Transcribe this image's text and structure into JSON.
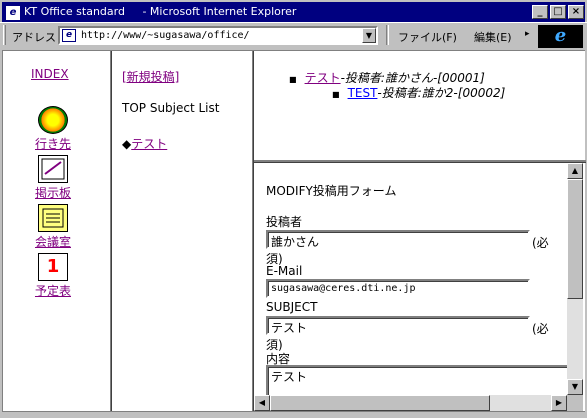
{
  "window": {
    "title": "KT Office standard     - Microsoft Internet Explorer",
    "app_icon": "ie-icon",
    "controls": {
      "minimize": "_",
      "maximize": "□",
      "close": "×"
    }
  },
  "address_bar": {
    "label": "アドレス",
    "url": "http://www/~sugasawa/office/",
    "dropdown_glyph": "▼"
  },
  "menu": {
    "file": "ファイル(F)",
    "edit": "編集(E)",
    "more": "▸",
    "logo": "e"
  },
  "left_nav": {
    "index": "INDEX",
    "items": [
      {
        "label": "行き先",
        "icon": "compass-icon"
      },
      {
        "label": "掲示板",
        "icon": "bulletin-board-icon"
      },
      {
        "label": "会議室",
        "icon": "meeting-room-icon"
      },
      {
        "label": "予定表",
        "icon": "calendar-icon",
        "glyph": "1"
      }
    ]
  },
  "middle": {
    "new_post": "[新規投稿]",
    "subject_list_title": "TOP Subject List",
    "subject_bullet": "◆",
    "subject_item": "テスト"
  },
  "posts": [
    {
      "bullet": "■",
      "title": "テスト",
      "meta": "-投稿者:誰かさん-[00001]"
    },
    {
      "bullet": "■",
      "title": "TEST",
      "meta": "-投稿者:誰か2-[00002]"
    }
  ],
  "form": {
    "title": "MODIFY投稿用フォーム",
    "poster_label": "投稿者",
    "poster_value": "誰かさん",
    "required_note_a": "(必",
    "required_note_b": "須)",
    "email_label": "E-Mail",
    "email_value": "sugasawa@ceres.dti.ne.jp",
    "subject_label": "SUBJECT",
    "subject_value": "テスト",
    "body_label": "内容",
    "body_value": "テスト"
  },
  "scrollbar": {
    "up": "▲",
    "down": "▼",
    "left": "◀",
    "right": "▶"
  }
}
